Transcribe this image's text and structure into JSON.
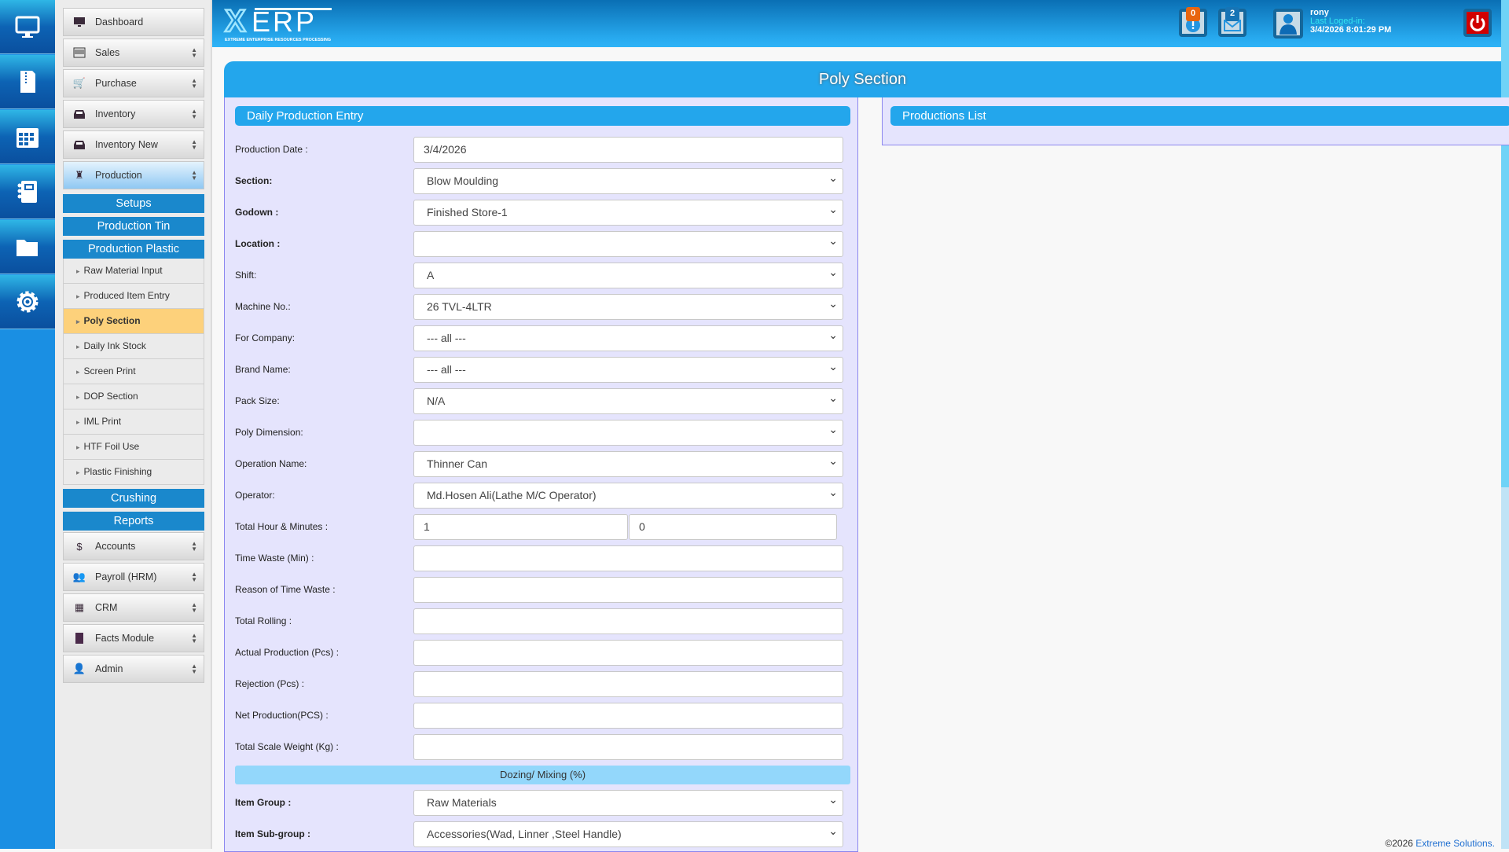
{
  "app": {
    "logo_text": "XERP",
    "logo_subtitle": "EXTREME ENTERPRISE RESOURCES PROCESSING"
  },
  "iconbar": [
    "monitor-icon",
    "zip-file-icon",
    "calendar-icon",
    "notebook-icon",
    "folder-icon",
    "gear-icon"
  ],
  "sidebar": {
    "top_items": [
      {
        "label": "Dashboard",
        "icon": "monitor-icon"
      },
      {
        "label": "Sales",
        "icon": "barcode-icon"
      },
      {
        "label": "Purchase",
        "icon": "cart-icon"
      },
      {
        "label": "Inventory",
        "icon": "inbox-icon"
      },
      {
        "label": "Inventory New",
        "icon": "inbox-icon"
      },
      {
        "label": "Production",
        "icon": "flask-icon"
      }
    ],
    "headers": {
      "setups": "Setups",
      "tin": "Production Tin",
      "plastic": "Production Plastic",
      "crushing": "Crushing",
      "reports": "Reports"
    },
    "plastic_items": [
      "Raw Material Input",
      "Produced Item Entry",
      "Poly Section",
      "Daily Ink Stock",
      "Screen Print",
      "DOP Section",
      "IML Print",
      "HTF Foil Use",
      "Plastic Finishing"
    ],
    "active_sub": "Poly Section",
    "bottom_items": [
      {
        "label": "Accounts",
        "icon": "coins-icon"
      },
      {
        "label": "Payroll (HRM)",
        "icon": "users-icon"
      },
      {
        "label": "CRM",
        "icon": "flag-icon"
      },
      {
        "label": "Facts Module",
        "icon": "book-icon"
      },
      {
        "label": "Admin",
        "icon": "user-tie-icon"
      }
    ]
  },
  "header": {
    "alerts_count": "0",
    "messages_count": "2",
    "username": "rony",
    "last_login_label": "Last Loged-in:",
    "last_login": "3/4/2026 8:01:29 PM"
  },
  "page": {
    "title": "Poly Section",
    "entry_title": "Daily Production Entry",
    "list_title": "Productions List"
  },
  "form": {
    "rows": [
      {
        "label": "Production Date :",
        "value": "3/4/2026",
        "type": "input",
        "bold": false
      },
      {
        "label": "Section:",
        "value": "Blow Moulding",
        "type": "select",
        "bold": true
      },
      {
        "label": "Godown :",
        "value": "Finished Store-1",
        "type": "select",
        "bold": true
      },
      {
        "label": "Location :",
        "value": "",
        "type": "select",
        "bold": true
      },
      {
        "label": "Shift:",
        "value": "A",
        "type": "select",
        "bold": false
      },
      {
        "label": "Machine No.:",
        "value": "26 TVL-4LTR",
        "type": "select",
        "bold": false
      },
      {
        "label": "For Company:",
        "value": "--- all ---",
        "type": "select",
        "bold": false
      },
      {
        "label": "Brand Name:",
        "value": "--- all ---",
        "type": "select",
        "bold": false
      },
      {
        "label": "Pack Size:",
        "value": "N/A",
        "type": "select",
        "bold": false
      },
      {
        "label": "Poly Dimension:",
        "value": "",
        "type": "select",
        "bold": false
      },
      {
        "label": "Operation Name:",
        "value": "Thinner Can",
        "type": "select",
        "bold": false
      },
      {
        "label": "Operator:",
        "value": "Md.Hosen Ali(Lathe M/C Operator)",
        "type": "select",
        "bold": false
      },
      {
        "label": "Total Hour & Minutes :",
        "value": "1",
        "value2": "0",
        "type": "pair",
        "bold": false
      },
      {
        "label": "Time Waste (Min) :",
        "value": "",
        "type": "input",
        "bold": false
      },
      {
        "label": "Reason of Time Waste :",
        "value": "",
        "type": "input",
        "bold": false
      },
      {
        "label": "Total Rolling :",
        "value": "",
        "type": "input",
        "bold": false
      },
      {
        "label": "Actual Production (Pcs) :",
        "value": "",
        "type": "input",
        "bold": false
      },
      {
        "label": "Rejection (Pcs) :",
        "value": "",
        "type": "input",
        "bold": false
      },
      {
        "label": "Net Production(PCS) :",
        "value": "",
        "type": "input",
        "bold": false
      },
      {
        "label": "Total Scale Weight (Kg) :",
        "value": "",
        "type": "input",
        "bold": false
      }
    ],
    "dozing_title": "Dozing/ Mixing (%)",
    "rows2": [
      {
        "label": "Item Group :",
        "value": "Raw Materials",
        "type": "select",
        "bold": true
      },
      {
        "label": "Item Sub-group :",
        "value": "Accessories(Wad, Linner ,Steel Handle)",
        "type": "select",
        "bold": true
      }
    ]
  },
  "footer": {
    "copyright": "©2026",
    "company": "Extreme Solutions."
  }
}
